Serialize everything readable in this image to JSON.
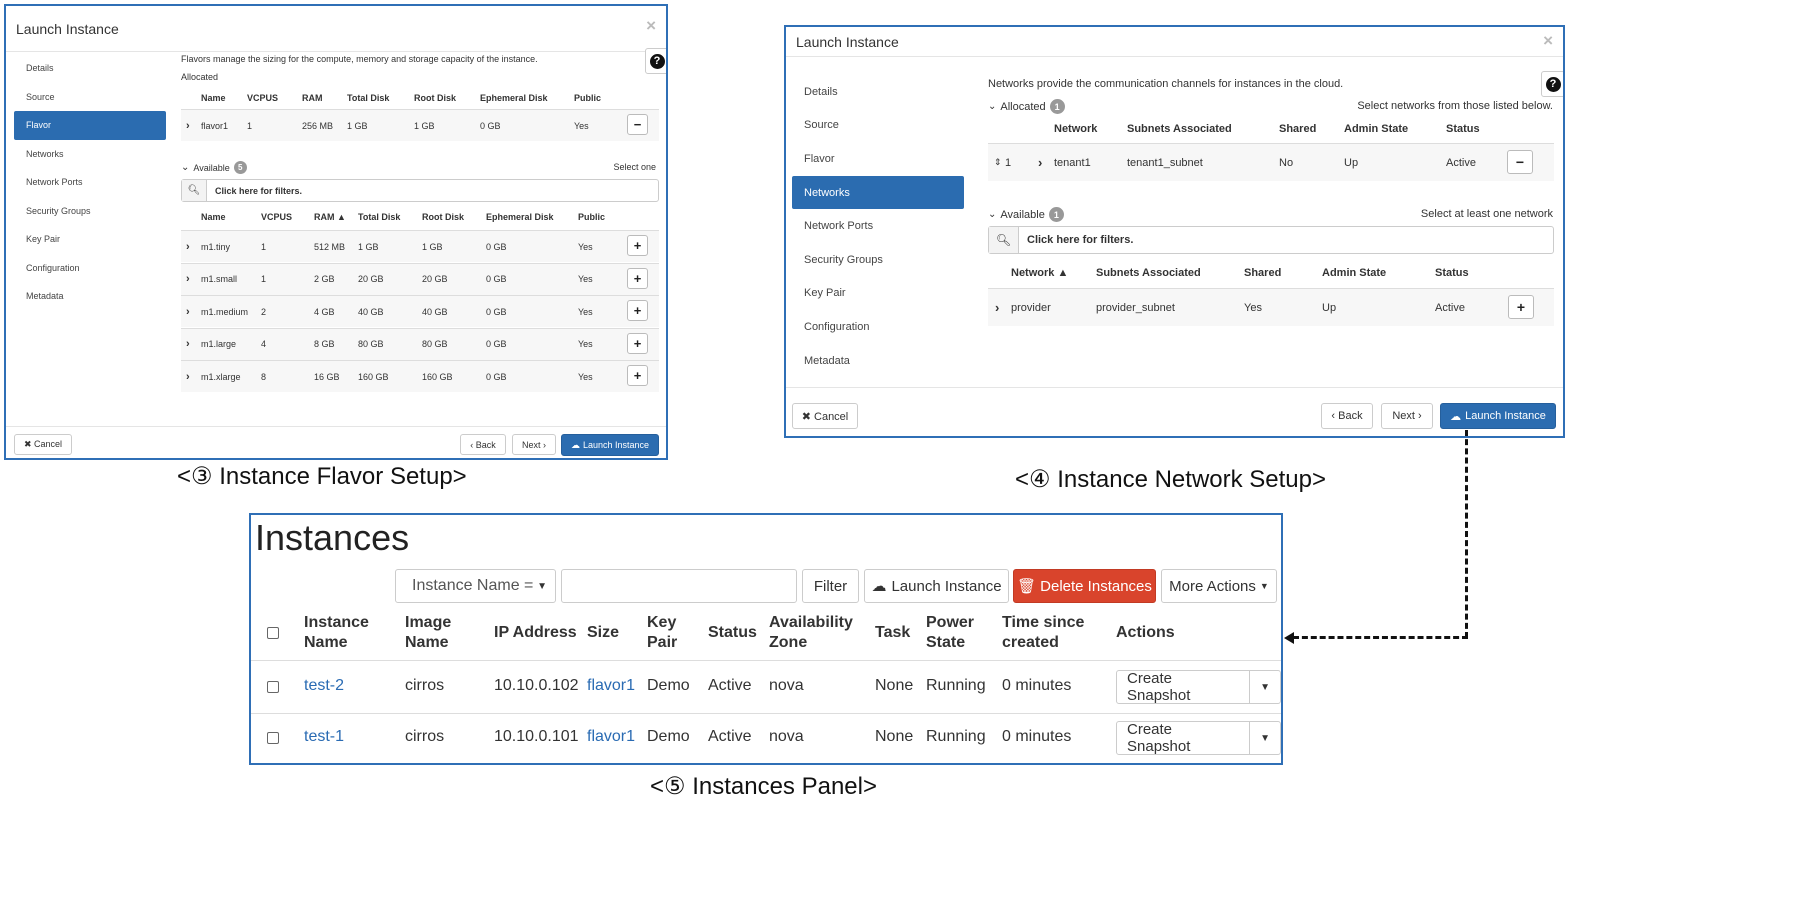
{
  "flavor_modal": {
    "title": "Launch Instance",
    "close": "×",
    "help": "?",
    "nav": [
      "Details",
      "Source",
      "Flavor",
      "Networks",
      "Network Ports",
      "Security Groups",
      "Key Pair",
      "Configuration",
      "Metadata"
    ],
    "active_nav": "Flavor",
    "description": "Flavors manage the sizing for the compute, memory and storage capacity of the instance.",
    "allocated_label": "Allocated",
    "allocated_headers": [
      "Name",
      "VCPUS",
      "RAM",
      "Total Disk",
      "Root Disk",
      "Ephemeral Disk",
      "Public"
    ],
    "allocated_rows": [
      [
        "flavor1",
        "1",
        "256 MB",
        "1 GB",
        "1 GB",
        "0 GB",
        "Yes"
      ]
    ],
    "available_label": "Available",
    "available_count": "5",
    "select_note": "Select one",
    "filter_placeholder": "Click here for filters.",
    "available_headers": [
      "Name",
      "VCPUS",
      "RAM ▲",
      "Total Disk",
      "Root Disk",
      "Ephemeral Disk",
      "Public"
    ],
    "available_rows": [
      [
        "m1.tiny",
        "1",
        "512 MB",
        "1 GB",
        "1 GB",
        "0 GB",
        "Yes"
      ],
      [
        "m1.small",
        "1",
        "2 GB",
        "20 GB",
        "20 GB",
        "0 GB",
        "Yes"
      ],
      [
        "m1.medium",
        "2",
        "4 GB",
        "40 GB",
        "40 GB",
        "0 GB",
        "Yes"
      ],
      [
        "m1.large",
        "4",
        "8 GB",
        "80 GB",
        "80 GB",
        "0 GB",
        "Yes"
      ],
      [
        "m1.xlarge",
        "8",
        "16 GB",
        "160 GB",
        "160 GB",
        "0 GB",
        "Yes"
      ]
    ],
    "cancel": "✖ Cancel",
    "back": "‹ Back",
    "next": "Next ›",
    "launch": "Launch Instance"
  },
  "network_modal": {
    "title": "Launch Instance",
    "close": "×",
    "help": "?",
    "nav": [
      "Details",
      "Source",
      "Flavor",
      "Networks",
      "Network Ports",
      "Security Groups",
      "Key Pair",
      "Configuration",
      "Metadata"
    ],
    "active_nav": "Networks",
    "description": "Networks provide the communication channels for instances in the cloud.",
    "allocated_label": "Allocated",
    "allocated_count": "1",
    "allocated_note": "Select networks from those listed below.",
    "allocated_headers": [
      "Network",
      "Subnets Associated",
      "Shared",
      "Admin State",
      "Status"
    ],
    "allocated_rows": [
      [
        "1",
        "tenant1",
        "tenant1_subnet",
        "No",
        "Up",
        "Active"
      ]
    ],
    "available_label": "Available",
    "available_count": "1",
    "available_note": "Select at least one network",
    "filter_placeholder": "Click here for filters.",
    "available_headers": [
      "Network ▲",
      "Subnets Associated",
      "Shared",
      "Admin State",
      "Status"
    ],
    "available_rows": [
      [
        "provider",
        "provider_subnet",
        "Yes",
        "Up",
        "Active"
      ]
    ],
    "cancel": "✖ Cancel",
    "back": "‹ Back",
    "next": "Next ›",
    "launch": "Launch Instance"
  },
  "instances_panel": {
    "title": "Instances",
    "filter_select": "Instance Name =",
    "filter_input": "",
    "filter_button": "Filter",
    "launch_button": "Launch Instance",
    "delete_button": "Delete Instances",
    "more_actions": "More Actions",
    "headers": {
      "name": [
        "Instance",
        "Name"
      ],
      "image": [
        "Image",
        "Name"
      ],
      "ip": "IP Address",
      "size": "Size",
      "keypair": [
        "Key",
        "Pair"
      ],
      "status": "Status",
      "zone": [
        "Availability",
        "Zone"
      ],
      "task": "Task",
      "power": [
        "Power",
        "State"
      ],
      "time": [
        "Time since",
        "created"
      ],
      "actions": "Actions"
    },
    "rows": [
      {
        "name": "test-2",
        "image": "cirros",
        "ip": "10.10.0.102",
        "size": "flavor1",
        "keypair": "Demo",
        "status": "Active",
        "zone": "nova",
        "task": "None",
        "power": "Running",
        "time": "0 minutes",
        "action": "Create Snapshot"
      },
      {
        "name": "test-1",
        "image": "cirros",
        "ip": "10.10.0.101",
        "size": "flavor1",
        "keypair": "Demo",
        "status": "Active",
        "zone": "nova",
        "task": "None",
        "power": "Running",
        "time": "0 minutes",
        "action": "Create Snapshot"
      }
    ]
  },
  "captions": {
    "flavor": "<③ Instance Flavor Setup>",
    "network": "<④ Instance Network Setup>",
    "instances": "<⑤ Instances Panel>"
  },
  "colors": {
    "frame": "#2f6fb6",
    "primary": "#2b6cb0",
    "danger": "#d9442c",
    "link": "#2a6bb3"
  }
}
